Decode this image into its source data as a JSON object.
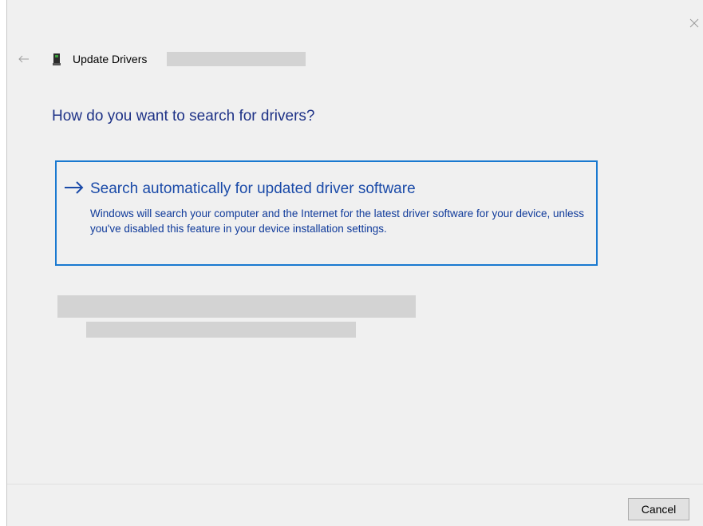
{
  "window": {
    "title": "Update Drivers",
    "icons": {
      "back": "back-arrow-icon",
      "close": "close-icon",
      "device": "device-icon",
      "option_arrow": "right-arrow-icon"
    }
  },
  "main": {
    "heading": "How do you want to search for drivers?",
    "option": {
      "title": "Search automatically for updated driver software",
      "description": "Windows will search your computer and the Internet for the latest driver software for your device, unless you've disabled this feature in your device installation settings."
    }
  },
  "footer": {
    "cancel_label": "Cancel"
  },
  "colors": {
    "heading": "#1e3287",
    "option_border": "#1979d0",
    "option_title": "#1a4aa8",
    "window_bg": "#f0f0f0",
    "redacted": "#d3d3d3"
  }
}
